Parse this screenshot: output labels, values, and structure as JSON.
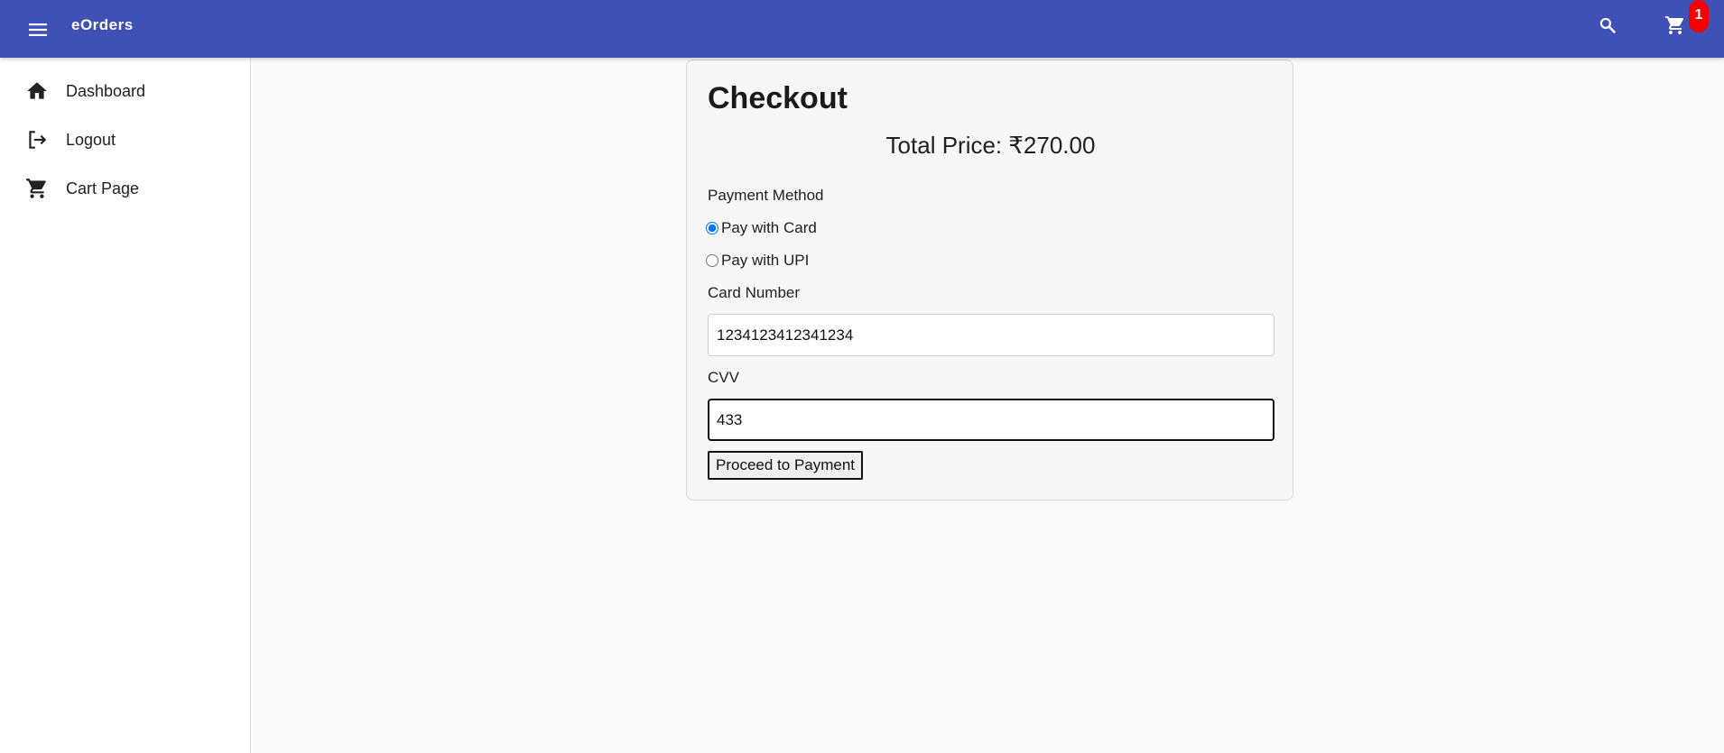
{
  "header": {
    "app_title": "eOrders",
    "cart_count": "1",
    "brand_color": "#3f51b5",
    "badge_color": "#f40000"
  },
  "sidebar": {
    "items": [
      {
        "label": "Dashboard",
        "icon": "home-icon"
      },
      {
        "label": "Logout",
        "icon": "logout-icon"
      },
      {
        "label": "Cart Page",
        "icon": "cart-icon"
      }
    ]
  },
  "checkout": {
    "title": "Checkout",
    "total_price": "Total Price: ₹270.00",
    "payment_method_label": "Payment Method",
    "options": [
      {
        "label": "Pay with Card",
        "selected": true
      },
      {
        "label": "Pay with UPI",
        "selected": false
      }
    ],
    "card_number_label": "Card Number",
    "card_number_value": "1234123412341234",
    "cvv_label": "CVV",
    "cvv_value": "433",
    "proceed_button": "Proceed to Payment"
  }
}
